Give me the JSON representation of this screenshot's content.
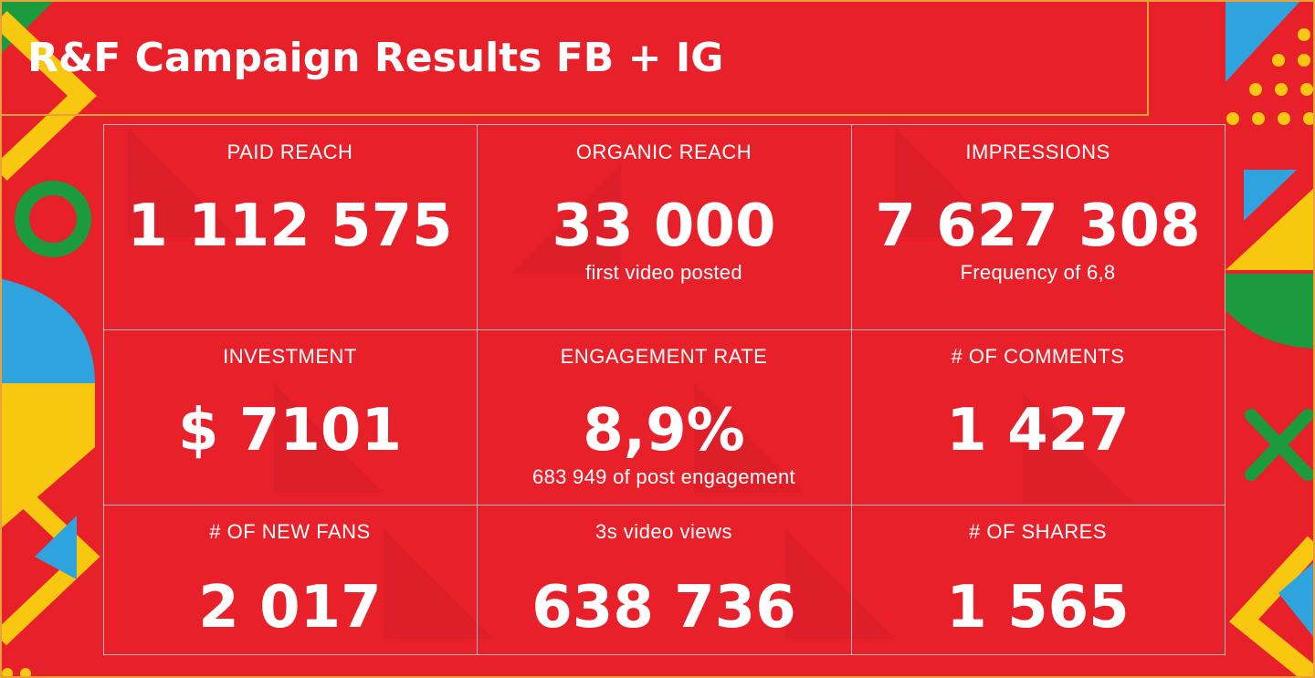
{
  "title": "R&F Campaign Results FB + IG",
  "colors": {
    "background": "#e8202a",
    "yellow": "#f7c80f",
    "blue": "#2fa3de",
    "green": "#1c9a3e",
    "text": "#ffffff"
  },
  "metrics": [
    {
      "label": "PAID REACH",
      "value": "1 112 575",
      "sub": ""
    },
    {
      "label": "ORGANIC REACH",
      "value": "33 000",
      "sub": "first video posted"
    },
    {
      "label": "IMPRESSIONS",
      "value": "7 627 308",
      "sub": "Frequency of 6,8"
    },
    {
      "label": "INVESTMENT",
      "value": "$ 7101",
      "sub": ""
    },
    {
      "label": "ENGAGEMENT RATE",
      "value": "8,9%",
      "sub": "683 949 of post engagement"
    },
    {
      "label": "# OF COMMENTS",
      "value": "1 427",
      "sub": ""
    },
    {
      "label": "# OF NEW FANS",
      "value": "2 017",
      "sub": ""
    },
    {
      "label": "3s video views",
      "value": "638 736",
      "sub": ""
    },
    {
      "label": "# OF SHARES",
      "value": "1 565",
      "sub": ""
    }
  ]
}
